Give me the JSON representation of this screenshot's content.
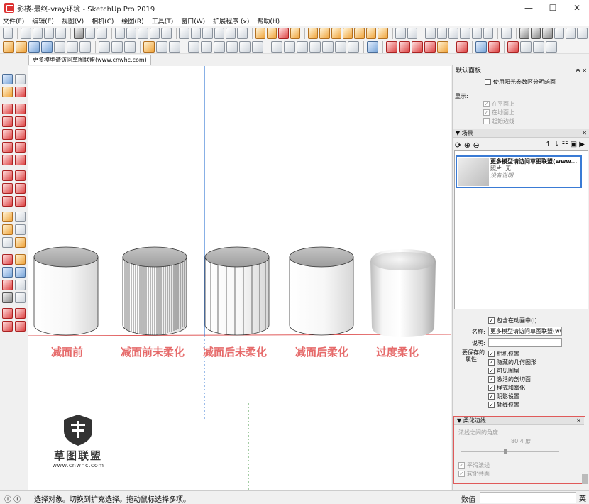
{
  "window": {
    "title": "影楼-最终-vray环境 - SketchUp Pro 2019",
    "controls": [
      "—",
      "☐",
      "✕"
    ]
  },
  "menu": [
    "文件(F)",
    "编辑(E)",
    "视图(V)",
    "相机(C)",
    "绘图(R)",
    "工具(T)",
    "窗口(W)",
    "扩展程序 (x)",
    "帮助(H)"
  ],
  "scene_tab": "更多模型请访问草图联盟(www.cnwhc.com)",
  "viewport": {
    "labels": [
      "减面前",
      "减面前未柔化",
      "减面后未柔化",
      "减面后柔化",
      "过度柔化"
    ],
    "logo": {
      "name": "草图联盟",
      "url": "www.cnwhc.com"
    }
  },
  "default_panel": {
    "title": "默认面板",
    "shadow_option": "使用阳光参数区分明暗面",
    "display_label": "显示:",
    "display_items": [
      {
        "label": "在平面上",
        "checked": true
      },
      {
        "label": "在地面上",
        "checked": true
      },
      {
        "label": "起始边线",
        "checked": false
      }
    ]
  },
  "scenes": {
    "title": "场景",
    "item": {
      "name": "更多模型请访问草图联盟(www...",
      "photo": "照片: 无",
      "desc": "没有说明"
    },
    "include_in_animation": "包含在动画中(I)",
    "name_label": "名称:",
    "name_value": "更多模型请访问草图联盟(ww",
    "desc_label": "说明:",
    "desc_value": "",
    "props_label_1": "要保存的",
    "props_label_2": "属性:",
    "props": [
      {
        "label": "相机位置",
        "checked": true
      },
      {
        "label": "隐藏的几何图形",
        "checked": true
      },
      {
        "label": "可见图层",
        "checked": true
      },
      {
        "label": "激活的剖切面",
        "checked": true
      },
      {
        "label": "样式和雾化",
        "checked": true
      },
      {
        "label": "阴影设置",
        "checked": true
      },
      {
        "label": "轴线位置",
        "checked": true
      }
    ]
  },
  "soften": {
    "title": "柔化边线",
    "angle_label": "法线之间的角度:",
    "angle_value": "80.4",
    "angle_unit": "度",
    "slider_fraction": 0.45,
    "options": [
      {
        "label": "平滑法线",
        "checked": true
      },
      {
        "label": "软化共面",
        "checked": true
      }
    ]
  },
  "status": {
    "hint": "选择对象。切换到扩充选择。拖动鼠标选择多项。",
    "measure_label": "数值",
    "ime": "英"
  },
  "colors": {
    "label_red": "#e66b6b",
    "selection_blue": "#3a7bd5",
    "highlight_red": "#e05a5a"
  }
}
